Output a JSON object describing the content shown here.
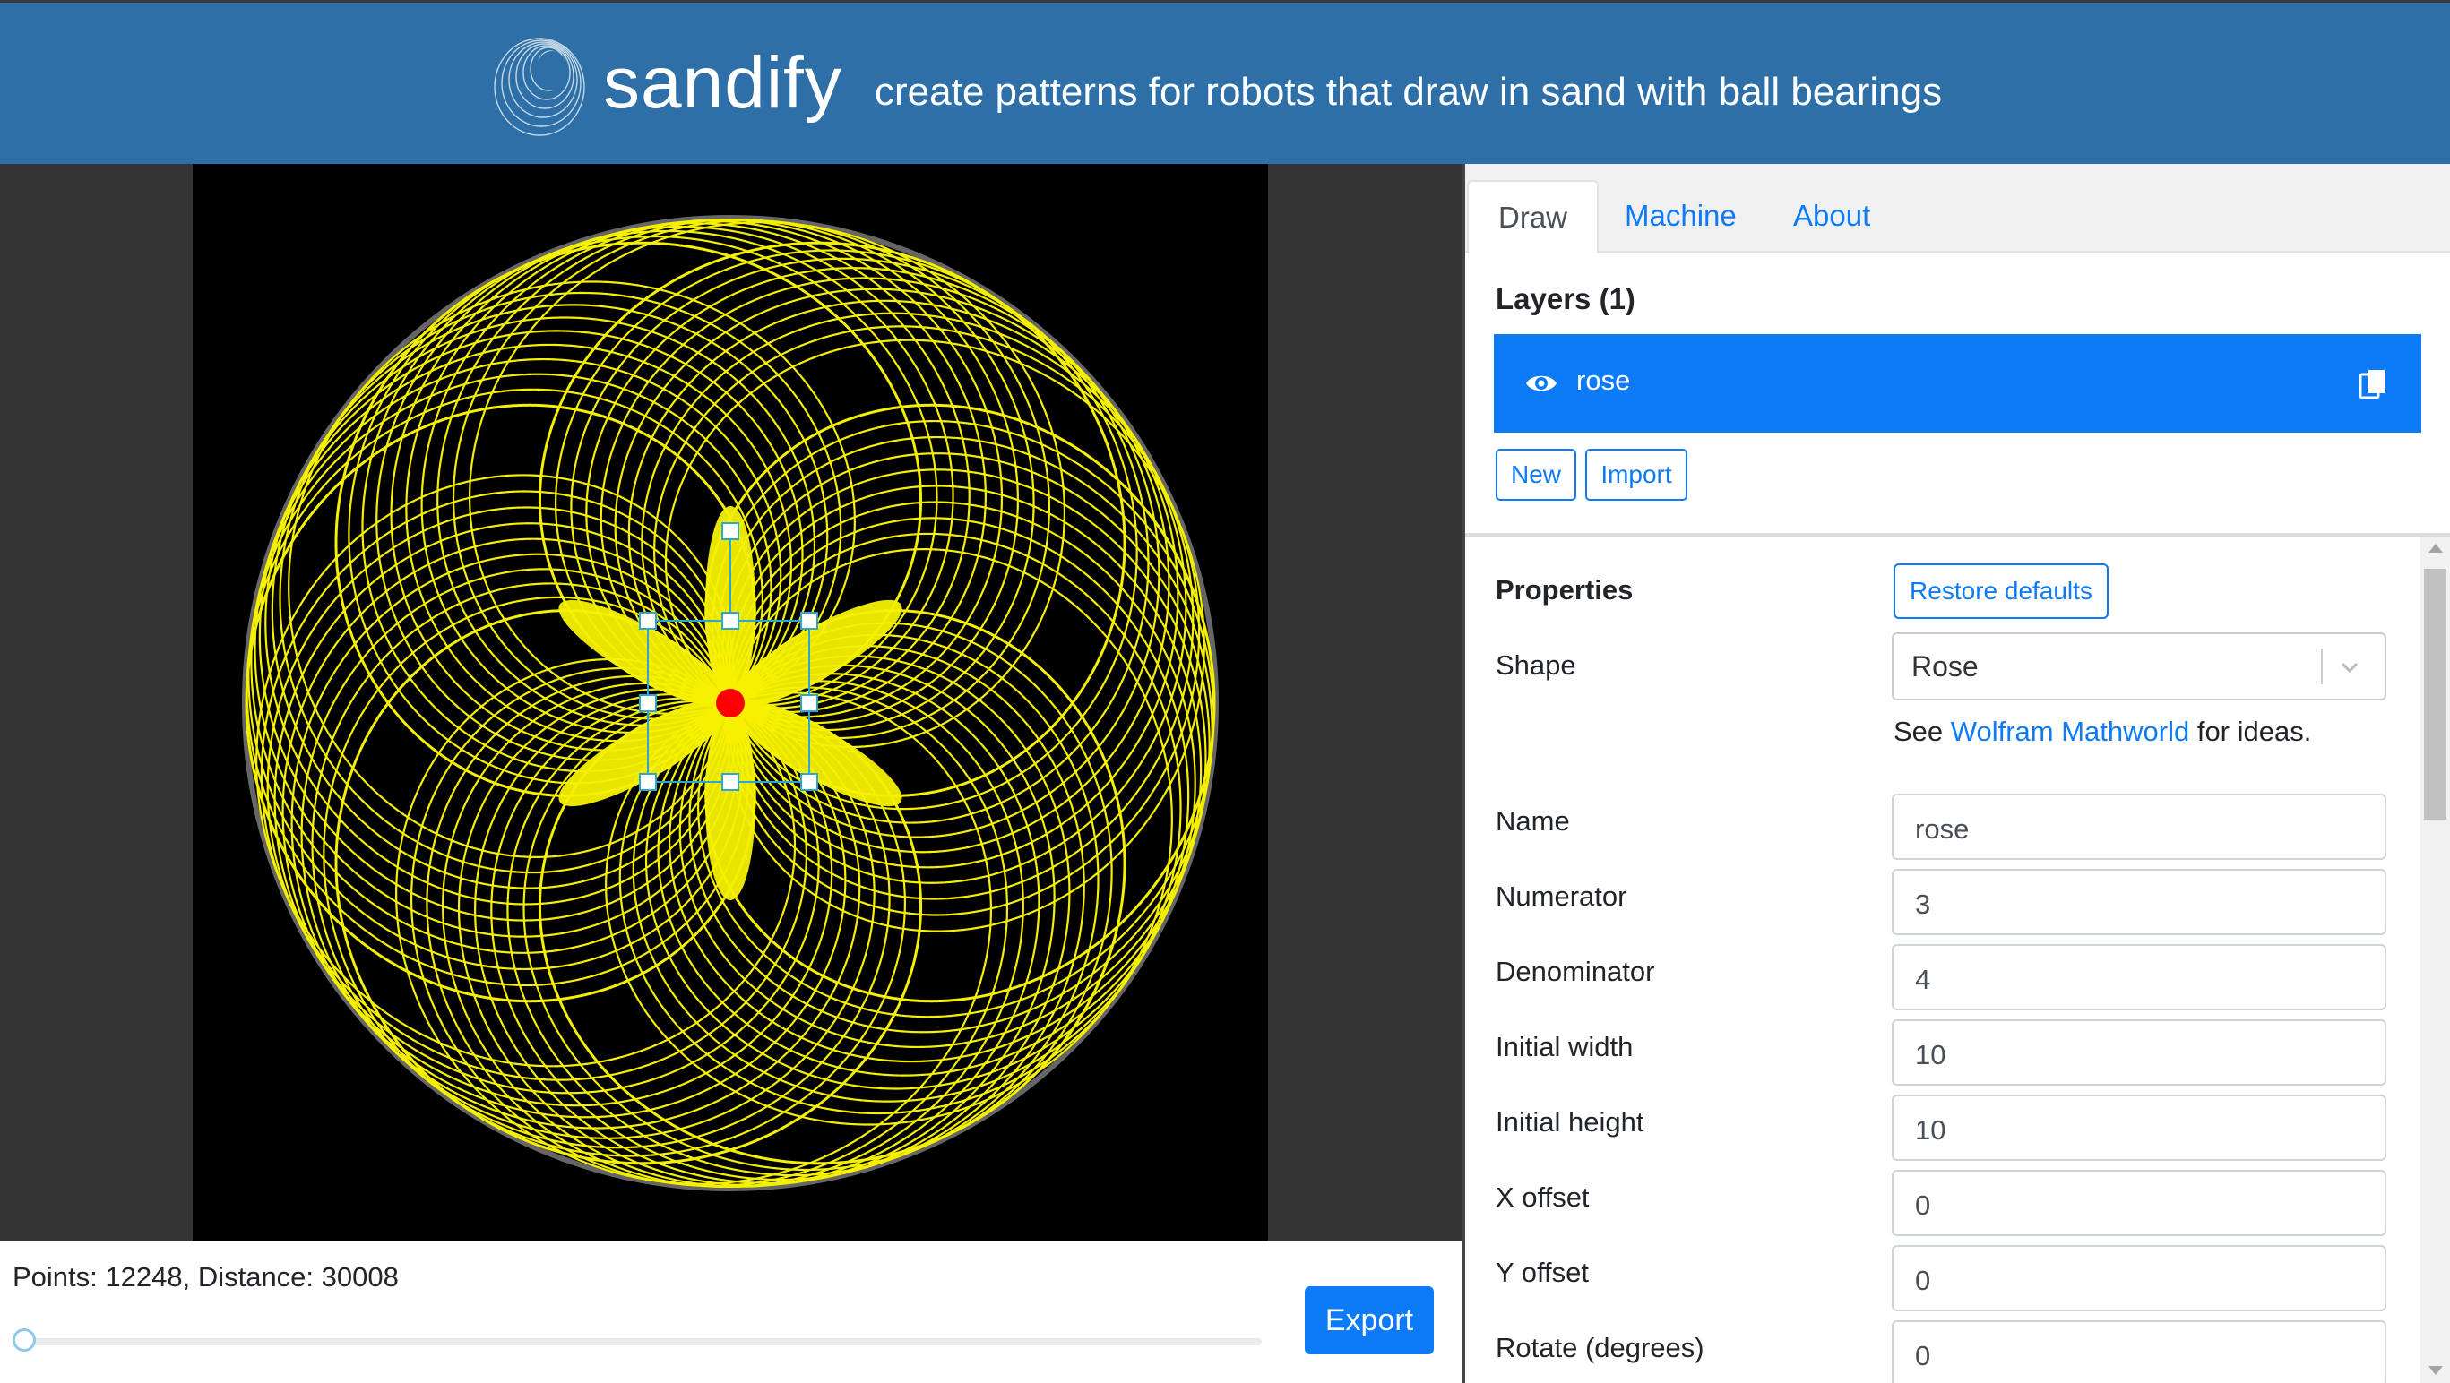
{
  "header": {
    "brand": "sandify",
    "tagline": "create patterns for robots that draw in sand with ball bearings"
  },
  "preview": {
    "stats": "Points: 12248, Distance: 30008",
    "export_label": "Export",
    "slider_position": 0
  },
  "tabs": [
    {
      "label": "Draw",
      "active": true
    },
    {
      "label": "Machine",
      "active": false
    },
    {
      "label": "About",
      "active": false
    }
  ],
  "layers": {
    "title": "Layers (1)",
    "items": [
      {
        "name": "rose",
        "selected": true
      }
    ],
    "new_label": "New",
    "import_label": "Import"
  },
  "properties": {
    "title": "Properties",
    "restore_label": "Restore defaults",
    "shape_label": "Shape",
    "shape_value": "Rose",
    "hint_prefix": "See ",
    "hint_link": "Wolfram Mathworld",
    "hint_suffix": " for ideas.",
    "fields": [
      {
        "label": "Name",
        "value": "rose"
      },
      {
        "label": "Numerator",
        "value": "3"
      },
      {
        "label": "Denominator",
        "value": "4"
      },
      {
        "label": "Initial width",
        "value": "10"
      },
      {
        "label": "Initial height",
        "value": "10"
      },
      {
        "label": "X offset",
        "value": "0"
      },
      {
        "label": "Y offset",
        "value": "0"
      },
      {
        "label": "Rotate (degrees)",
        "value": "0"
      }
    ]
  },
  "colors": {
    "header_bg": "#2d6fa6",
    "accent": "#0d7bf7",
    "pattern": "#f5f000",
    "center_dot": "#ff0000"
  },
  "icons": [
    "sandify-logo-icon",
    "eye-icon",
    "copy-icon",
    "chevron-down-icon"
  ]
}
